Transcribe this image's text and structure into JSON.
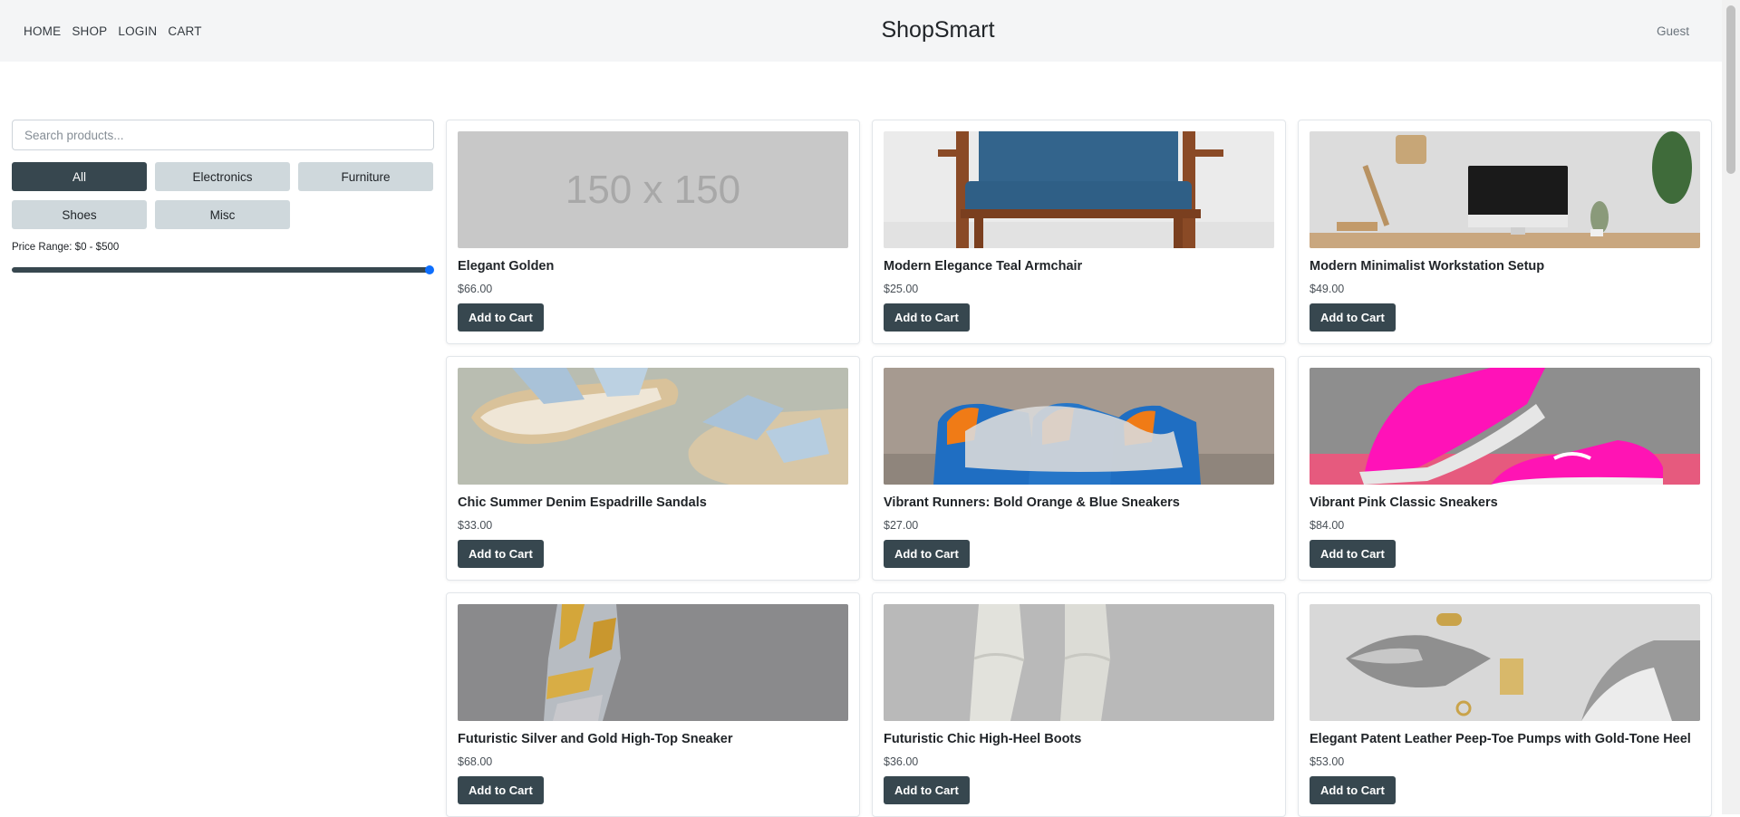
{
  "header": {
    "nav": [
      "HOME",
      "SHOP",
      "LOGIN",
      "CART"
    ],
    "brand": "ShopSmart",
    "user": "Guest"
  },
  "sidebar": {
    "search_placeholder": "Search products...",
    "categories": [
      "All",
      "Electronics",
      "Furniture",
      "Shoes",
      "Misc"
    ],
    "active_category": "All",
    "price_label": "Price Range: $0 - $500",
    "price_max_fraction": 1.0
  },
  "products": [
    {
      "name": "Elegant Golden",
      "price": "$66.00",
      "button": "Add to Cart",
      "image": "placeholder",
      "placeholder_text": "150 x 150"
    },
    {
      "name": "Modern Elegance Teal Armchair",
      "price": "$25.00",
      "button": "Add to Cart",
      "image": "armchair"
    },
    {
      "name": "Modern Minimalist Workstation Setup",
      "price": "$49.00",
      "button": "Add to Cart",
      "image": "workstation"
    },
    {
      "name": "Chic Summer Denim Espadrille Sandals",
      "price": "$33.00",
      "button": "Add to Cart",
      "image": "sandals"
    },
    {
      "name": "Vibrant Runners: Bold Orange & Blue Sneakers",
      "price": "$27.00",
      "button": "Add to Cart",
      "image": "orange-blue-sneakers"
    },
    {
      "name": "Vibrant Pink Classic Sneakers",
      "price": "$84.00",
      "button": "Add to Cart",
      "image": "pink-sneakers"
    },
    {
      "name": "Futuristic Silver and Gold High-Top Sneaker",
      "price": "$68.00",
      "button": "Add to Cart",
      "image": "silver-gold-sneaker"
    },
    {
      "name": "Futuristic Chic High-Heel Boots",
      "price": "$36.00",
      "button": "Add to Cart",
      "image": "white-boots"
    },
    {
      "name": "Elegant Patent Leather Peep-Toe Pumps with Gold-Tone Heel",
      "price": "$53.00",
      "button": "Add to Cart",
      "image": "peep-toe-pumps"
    }
  ],
  "colors": {
    "primary_dark": "#37474f",
    "category_bg": "#cfd8dc",
    "slider_handle": "#0d6efd",
    "header_bg": "#f4f5f6"
  }
}
